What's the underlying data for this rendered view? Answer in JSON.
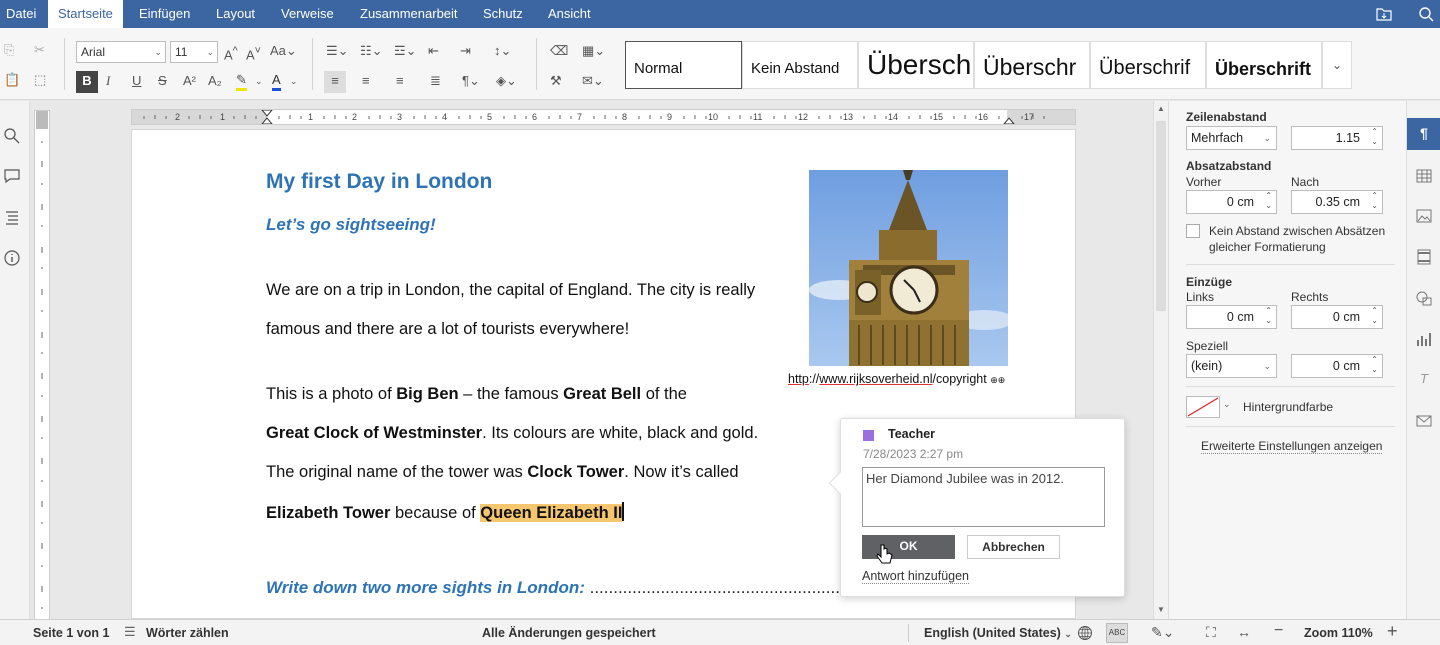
{
  "menu": {
    "tabs": [
      "Datei",
      "Startseite",
      "Einfügen",
      "Layout",
      "Verweise",
      "Zusammenarbeit",
      "Schutz",
      "Ansicht"
    ],
    "active_tab": "Startseite"
  },
  "toolbar": {
    "font_name": "Arial",
    "font_size": "11",
    "bold": "B",
    "italic": "I",
    "underline": "U",
    "strikethrough": "S",
    "superscript": "A²",
    "subscript": "A₂",
    "grow_font": "A^",
    "shrink_font": "A˅",
    "change_case": "Aa",
    "styles": [
      "Normal",
      "Kein Abstand",
      "Übersch",
      "Überschr",
      "Überschrif",
      "Überschrift"
    ]
  },
  "document": {
    "title": "My first Day in London",
    "subtitle": "Let’s go sightseeing!",
    "para1_line1": "We are on a trip in London, the capital of England. The city is really",
    "para1_line2": "famous and there are a lot of tourists everywhere!",
    "para2_l1_a": "This is a photo of ",
    "para2_l1_b": "Big Ben",
    "para2_l1_c": " – the famous ",
    "para2_l1_d": "Great Bell",
    "para2_l1_e": " of the",
    "para2_l2_a": "Great Clock of Westminster",
    "para2_l2_b": ". Its colours are white, black and gold.",
    "para2_l3_a": "The original name of the tower was ",
    "para2_l3_b": "Clock Tower",
    "para2_l3_c": ". Now it’s called",
    "para2_l4_a": "Elizabeth Tower",
    "para2_l4_b": " because of ",
    "para2_l4_c": "Queen Elizabeth II",
    "task": "Write down two more sights in London:",
    "task_dots": " .........................................................",
    "image_caption_a": "http",
    "image_caption_b": "://",
    "image_caption_c": "www.rijksoverheid.nl",
    "image_caption_d": "/copyright",
    "image_caption_icon": "⊕⊕"
  },
  "comment": {
    "author": "Teacher",
    "author_color": "#9b6fe0",
    "date": "7/28/2023 2:27 pm",
    "text": "Her Diamond Jubilee was in 2012.",
    "ok_label": "OK",
    "cancel_label": "Abbrechen",
    "reply_label": "Antwort hinzufügen"
  },
  "panel": {
    "line_spacing_label": "Zeilenabstand",
    "line_spacing_mode": "Mehrfach",
    "line_spacing_value": "1.15",
    "para_spacing_label": "Absatzabstand",
    "before_label": "Vorher",
    "before_value": "0 cm",
    "after_label": "Nach",
    "after_value": "0.35 cm",
    "no_space_label_1": "Kein Abstand zwischen Absätzen",
    "no_space_label_2": "gleicher Formatierung",
    "indents_label": "Einzüge",
    "left_label": "Links",
    "left_value": "0 cm",
    "right_label": "Rechts",
    "right_value": "0 cm",
    "special_label": "Speziell",
    "special_mode": "(kein)",
    "special_value": "0 cm",
    "bg_color_label": "Hintergrundfarbe",
    "advanced_label": "Erweiterte Einstellungen anzeigen"
  },
  "status": {
    "page": "Seite 1 von 1",
    "word_count": "Wörter zählen",
    "save_state": "Alle Änderungen gespeichert",
    "language": "English (United States)",
    "zoom": "Zoom 110%"
  },
  "colors": {
    "accent": "#3b66a1",
    "heading": "#2e74b5",
    "highlight": "#f6c66e"
  }
}
